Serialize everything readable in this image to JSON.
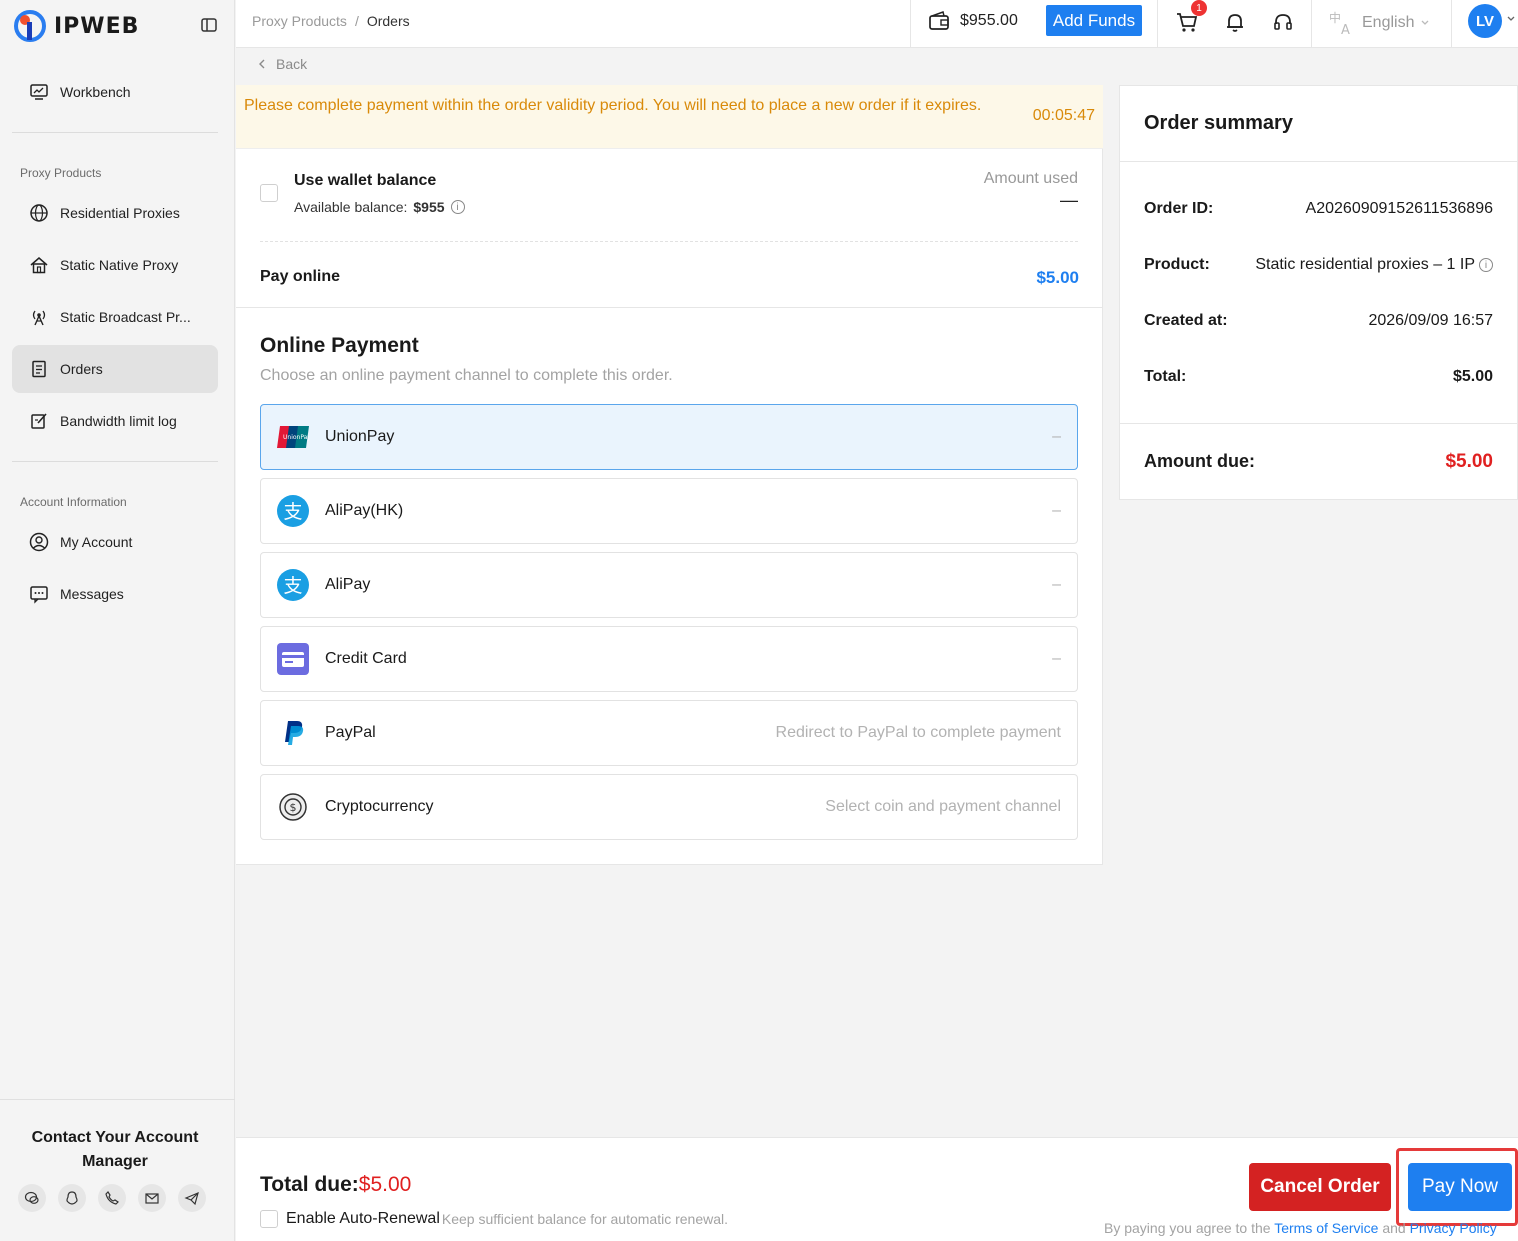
{
  "brand": {
    "name": "IPWEB"
  },
  "sidebar": {
    "workbench": "Workbench",
    "group_proxy": "Proxy Products",
    "items": [
      {
        "label": "Residential Proxies",
        "icon": "globe-icon"
      },
      {
        "label": "Static Native Proxy",
        "icon": "home-icon"
      },
      {
        "label": "Static Broadcast Pr...",
        "icon": "antenna-icon"
      },
      {
        "label": "Orders",
        "icon": "orders-icon",
        "active": true
      },
      {
        "label": "Bandwidth limit log",
        "icon": "edit-icon"
      }
    ],
    "group_account": "Account Information",
    "account_items": [
      {
        "label": "My Account",
        "icon": "user-icon"
      },
      {
        "label": "Messages",
        "icon": "message-icon"
      }
    ],
    "contact_title": "Contact Your Account Manager"
  },
  "topbar": {
    "breadcrumb": [
      "Proxy Products",
      "/",
      "Orders"
    ],
    "balance": "$955.00",
    "add_funds": "Add Funds",
    "cart_badge": "1",
    "language": "English",
    "avatar": "LV"
  },
  "back": "Back",
  "warning": {
    "text": "Please complete payment within the order validity period. You will need to place a new order if it expires.",
    "timer": "00:05:47"
  },
  "wallet": {
    "title": "Use wallet balance",
    "available_label": "Available balance:",
    "available_value": "$955",
    "amount_used_label": "Amount used",
    "amount_used_value": "—"
  },
  "pay_online": {
    "label": "Pay online",
    "amount": "$5.00"
  },
  "online_payment": {
    "title": "Online Payment",
    "subtitle": "Choose an online payment channel to complete this order.",
    "methods": [
      {
        "label": "UnionPay",
        "right": "–",
        "selected": true
      },
      {
        "label": "AliPay(HK)",
        "right": "–"
      },
      {
        "label": "AliPay",
        "right": "–"
      },
      {
        "label": "Credit Card",
        "right": "–"
      },
      {
        "label": "PayPal",
        "right": "Redirect to PayPal to complete payment"
      },
      {
        "label": "Cryptocurrency",
        "right": "Select coin and payment channel"
      }
    ]
  },
  "summary": {
    "title": "Order summary",
    "order_id_label": "Order ID:",
    "order_id": "A20260909152611536896",
    "product_label": "Product:",
    "product": "Static residential proxies – 1 IP",
    "created_label": "Created at:",
    "created": "2026/09/09 16:57",
    "total_label": "Total:",
    "total": "$5.00",
    "due_label": "Amount due:",
    "due": "$5.00"
  },
  "bottom": {
    "total_due_label": "Total due:",
    "total_due": "$5.00",
    "auto_renew": "Enable Auto-Renewal",
    "auto_renew_hint": "Keep sufficient balance for automatic renewal.",
    "cancel": "Cancel Order",
    "pay_now": "Pay Now",
    "terms_prefix": "By paying you agree to the",
    "terms_link": "Terms of Service",
    "terms_and": "and",
    "privacy_link": "Privacy Policy"
  }
}
